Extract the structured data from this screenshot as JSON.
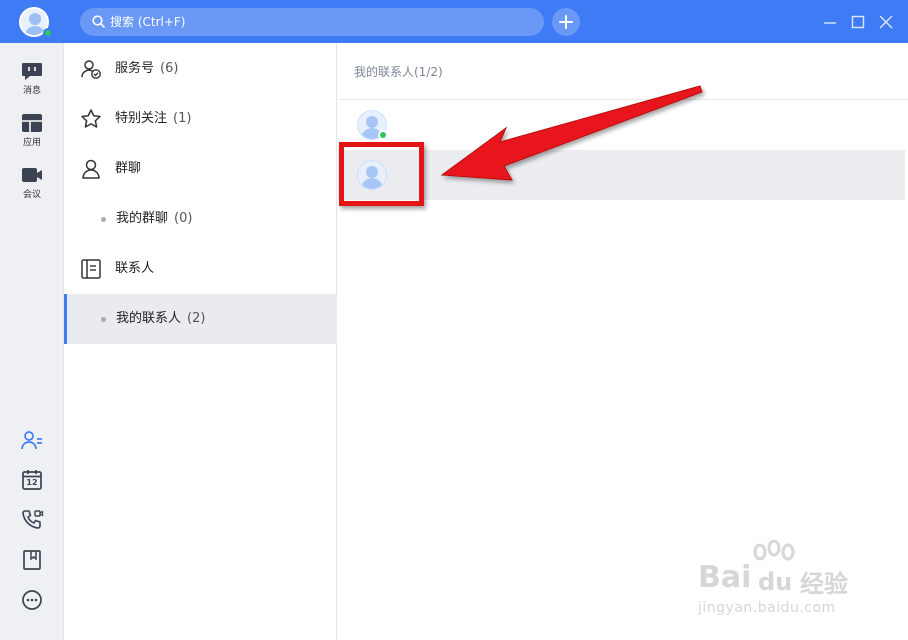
{
  "topbar": {
    "search_placeholder": "搜索 (Ctrl+F)",
    "bg_color": "#3f7bf5"
  },
  "rail": {
    "items": [
      {
        "label": "消息",
        "icon": "message-icon"
      },
      {
        "label": "应用",
        "icon": "apps-icon"
      },
      {
        "label": "会议",
        "icon": "meeting-icon"
      }
    ],
    "bottom_icons": [
      "contacts-icon",
      "calendar-icon",
      "call-icon",
      "bookmark-icon",
      "more-icon"
    ],
    "calendar_day": "12"
  },
  "nav": {
    "items": [
      {
        "label": "服务号",
        "count": "(6)",
        "icon": "service-account-icon"
      },
      {
        "label": "特别关注",
        "count": "(1)",
        "icon": "star-icon"
      },
      {
        "label": "群聊",
        "count": "",
        "icon": "group-chat-icon"
      },
      {
        "label": "我的群聊",
        "count": "(0)",
        "sub": true
      },
      {
        "label": "联系人",
        "count": "",
        "icon": "contacts-book-icon"
      },
      {
        "label": "我的联系人",
        "count": "(2)",
        "sub": true,
        "active": true
      }
    ]
  },
  "main": {
    "header": "我的联系人(1/2)",
    "contacts": [
      {
        "online": true,
        "selected": false
      },
      {
        "online": false,
        "selected": true
      }
    ]
  },
  "watermark": {
    "brand": "Bai",
    "brand2": "du",
    "cn": "经验",
    "url": "jingyan.baidu.com"
  }
}
